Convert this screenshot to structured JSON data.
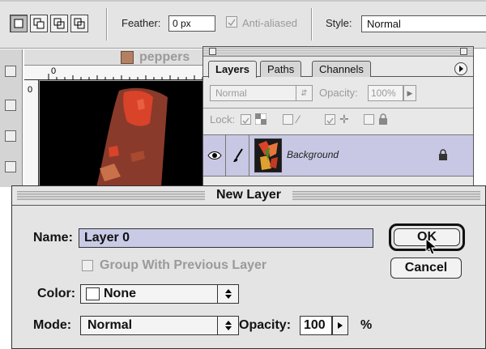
{
  "options_bar": {
    "feather_label": "Feather:",
    "feather_value": "0 px",
    "anti_aliased_label": "Anti-aliased",
    "style_label": "Style:",
    "style_value": "Normal"
  },
  "document": {
    "title": "peppers",
    "ruler_zero_top": "0",
    "ruler_zero_left": "0"
  },
  "layers_palette": {
    "tabs": [
      {
        "label": "Layers",
        "active": true
      },
      {
        "label": "Paths",
        "active": false
      },
      {
        "label": "Channels",
        "active": false
      }
    ],
    "blend_mode": "Normal",
    "opacity_label": "Opacity:",
    "opacity_value": "100%",
    "lock_label": "Lock:",
    "layer": {
      "name": "Background"
    }
  },
  "dialog": {
    "title": "New Layer",
    "name_label": "Name:",
    "name_value": "Layer 0",
    "ok_label": "OK",
    "cancel_label": "Cancel",
    "group_label": "Group With Previous Layer",
    "color_label": "Color:",
    "color_value": "None",
    "mode_label": "Mode:",
    "mode_value": "Normal",
    "opacity_label": "Opacity:",
    "opacity_value": "100",
    "percent": "%"
  },
  "colors": {
    "selection_highlight": "#c9cbe6",
    "layer_row": "#c8c8e4",
    "pepper_red": "#d9432a",
    "pepper_brown": "#8a3a2a"
  }
}
